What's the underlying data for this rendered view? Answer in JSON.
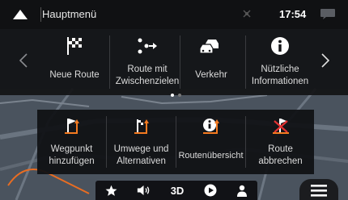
{
  "status_bar": {
    "title": "Hauptmenü",
    "time": "17:54"
  },
  "main_menu": {
    "items": [
      {
        "label": "Neue Route",
        "icon": "checkered-flag-icon"
      },
      {
        "label": "Route mit Zwischenzielen",
        "icon": "waypoints-icon"
      },
      {
        "label": "Verkehr",
        "icon": "traffic-cars-icon"
      },
      {
        "label": "Nützliche Informationen",
        "icon": "info-icon"
      }
    ],
    "page_count": 2,
    "current_page": 1
  },
  "route_menu": {
    "items": [
      {
        "label": "Wegpunkt hinzufügen",
        "icon": "add-waypoint-flag-icon"
      },
      {
        "label": "Umwege und Alternativen",
        "icon": "detour-flag-icon"
      },
      {
        "label": "Routenübersicht",
        "icon": "route-info-icon"
      },
      {
        "label": "Route abbrechen",
        "icon": "cancel-route-icon"
      }
    ]
  },
  "bottom_bar": {
    "view_mode": "3D",
    "icons": [
      "star-icon",
      "volume-icon",
      "play-icon",
      "person-icon",
      "hamburger-menu-icon"
    ]
  },
  "colors": {
    "accent_orange": "#f47a20",
    "cancel_red": "#e23232",
    "panel_bg": "#121316",
    "text": "#dcdcdc"
  }
}
